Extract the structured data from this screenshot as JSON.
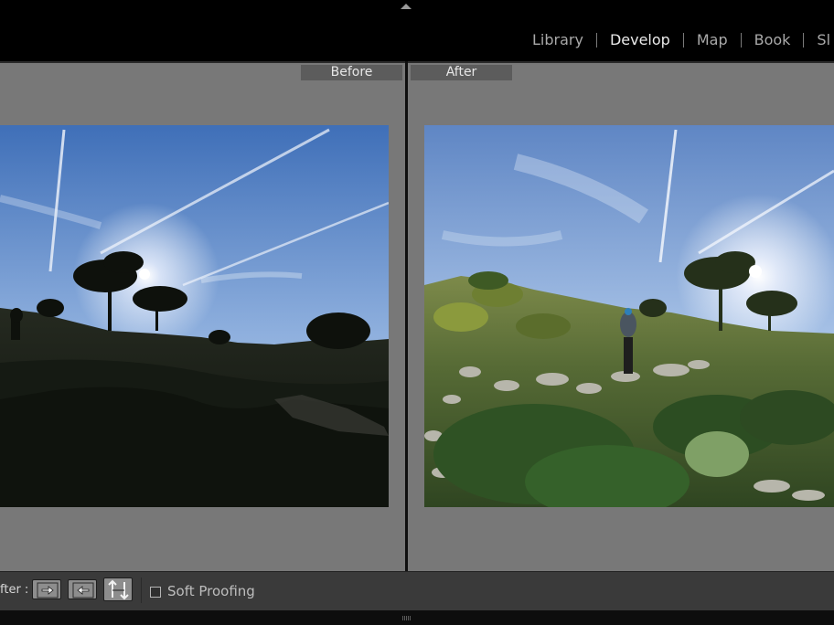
{
  "modules": [
    {
      "label": "Library",
      "active": false
    },
    {
      "label": "Develop",
      "active": true
    },
    {
      "label": "Map",
      "active": false
    },
    {
      "label": "Book",
      "active": false
    },
    {
      "label": "Sl",
      "active": false
    }
  ],
  "compare": {
    "before_label": "Before",
    "after_label": "After"
  },
  "toolbar": {
    "label": "fter :",
    "soft_proofing_label": "Soft Proofing",
    "soft_proofing_checked": false,
    "buttons": [
      "copy-before-to-after-icon",
      "copy-after-to-before-icon",
      "swap-before-after-icon"
    ]
  },
  "colors": {
    "panel_bg": "#787878",
    "label_bg": "#5c5c5c",
    "toolbar_bg": "#3a3a3a",
    "active_module": "#eaeaea",
    "inactive_module": "#a9a9a9"
  }
}
